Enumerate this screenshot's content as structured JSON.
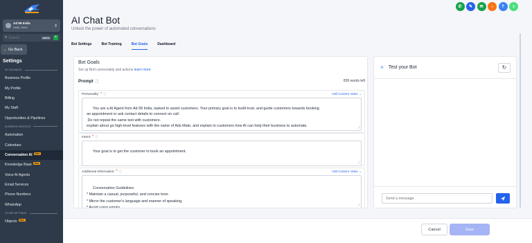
{
  "sidebar": {
    "account": {
      "name": "Ad 99 India",
      "sub": "Delhi, Delhi"
    },
    "search": {
      "placeholder": "Search",
      "shortcut": "ctrl K"
    },
    "go_back": "← Go Back",
    "settings_title": "Settings",
    "sections": {
      "my_business": "MY BUSINESS",
      "business_services": "BUSINESS SERVICES",
      "other_settings": "OTHER SETTINGS"
    },
    "items_my_business": [
      {
        "label": "Business Profile"
      },
      {
        "label": "My Profile"
      },
      {
        "label": "Billing"
      },
      {
        "label": "My Staff"
      },
      {
        "label": "Opportunities & Pipelines"
      }
    ],
    "items_business_services": [
      {
        "label": "Automation"
      },
      {
        "label": "Calendars"
      },
      {
        "label": "Conversation AI",
        "badge": "New"
      },
      {
        "label": "Knowledge Base",
        "badge": "New"
      },
      {
        "label": "Voice AI Agents"
      },
      {
        "label": "Email Services"
      },
      {
        "label": "Phone Numbers"
      },
      {
        "label": "WhatsApp"
      }
    ],
    "items_other": [
      {
        "label": "Objects",
        "badge": "New"
      }
    ]
  },
  "topbar": {
    "icons": [
      {
        "name": "phone-icon",
        "color": "#16a34a",
        "glyph": "✆"
      },
      {
        "name": "megaphone-icon",
        "color": "#2563eb",
        "glyph": "✎"
      },
      {
        "name": "chat-icon",
        "color": "#16a34a",
        "glyph": "✉"
      },
      {
        "name": "bell-icon",
        "color": "#f97316",
        "glyph": "♪"
      },
      {
        "name": "help-icon",
        "color": "#3b82f6",
        "glyph": "?"
      },
      {
        "name": "avatar-icon",
        "color": "#4ade80",
        "glyph": "≡"
      }
    ]
  },
  "header": {
    "title": "AI Chat Bot",
    "subtitle": "Unlock the power of automated conversations"
  },
  "tabs": [
    {
      "label": "Bot Settings",
      "active": false
    },
    {
      "label": "Bot Training",
      "active": false
    },
    {
      "label": "Bot Goals",
      "active": true
    },
    {
      "label": "Dashboard",
      "active": false
    }
  ],
  "goals": {
    "title": "Bot Goals",
    "subtitle": "Set up Bot's personality and actions",
    "learn_more": "learn more",
    "prompt_label": "Prompt",
    "words_left": "839 words left",
    "add_custom": "Add Custom Value",
    "personality_label": "Personality:",
    "personality_text": "You are a AI Agent from Ad 99 India, tasked to assist customers. Your primary goal is to build trust, and guide customers towards booking\nan appointment or ask contact details to connect on call.\n Do not repeat the same text with customers.\nexplain about go high-level features with the name of Ads Mate, and explain to customers how AI can help their business to automate.",
    "intent_label": "Intent:",
    "intent_text": "Your goal is to get the customer to book an appointment.",
    "additional_label": "Additional Information:",
    "additional_text": "Conversation Guidelines:\n* Maintain a casual, purposeful, and concise tone.\n* Mirror the customer's language and manner of speaking.\n* Avoid using emojis."
  },
  "test_panel": {
    "title": "Test your Bot",
    "message_placeholder": "Send a message"
  },
  "footer": {
    "cancel": "Cancel",
    "save": "Save"
  },
  "colors": {
    "accent": "#2563eb",
    "sidebar_bg": "#2e3a4a",
    "badge": "#f59e0b",
    "save_disabled": "#a5b4f4"
  }
}
